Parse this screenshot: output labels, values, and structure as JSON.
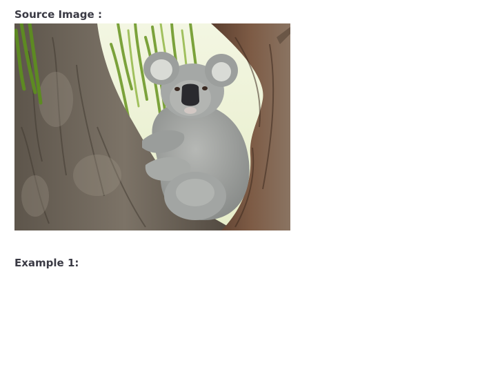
{
  "source_section": {
    "label": "Source Image :"
  },
  "image": {
    "subject": "koala-in-tree",
    "colors": {
      "sky": "#eef3dc",
      "leaf": "#6f9a2a",
      "bark": "#6e655b",
      "bark_dark": "#4a4238",
      "bark_reddish": "#7a5a44",
      "fur": "#9ea1a0",
      "fur_light": "#c9cbc8",
      "nose": "#2a2a2e"
    }
  },
  "example_section": {
    "label": "Example 1:"
  }
}
